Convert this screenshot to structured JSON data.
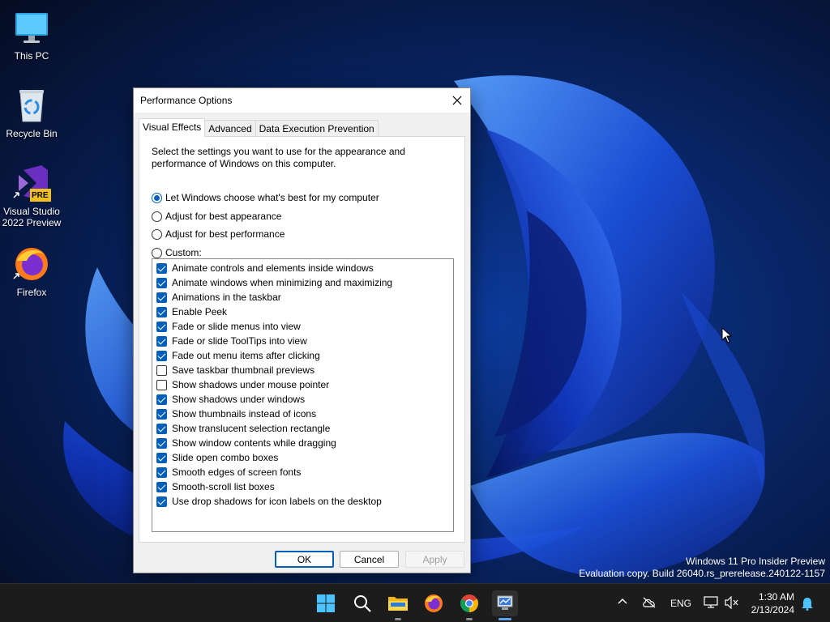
{
  "desktop": {
    "icons": [
      {
        "label": "This PC"
      },
      {
        "label": "Recycle Bin"
      },
      {
        "label": "Visual Studio 2022 Preview",
        "line1": "Visual Studio",
        "line2": "2022 Preview",
        "badge": "PRE"
      },
      {
        "label": "Firefox"
      }
    ],
    "watermark": {
      "line1": "Windows 11 Pro Insider Preview",
      "line2": "Evaluation copy. Build 26040.rs_prerelease.240122-1157"
    }
  },
  "dialog": {
    "title": "Performance Options",
    "tabs": [
      {
        "label": "Visual Effects",
        "active": true
      },
      {
        "label": "Advanced",
        "active": false
      },
      {
        "label": "Data Execution Prevention",
        "active": false
      }
    ],
    "description": "Select the settings you want to use for the appearance and performance of Windows on this computer.",
    "radios": [
      {
        "label": "Let Windows choose what's best for my computer",
        "checked": true
      },
      {
        "label": "Adjust for best appearance",
        "checked": false
      },
      {
        "label": "Adjust for best performance",
        "checked": false
      },
      {
        "label": "Custom:",
        "checked": false
      }
    ],
    "options": [
      {
        "label": "Animate controls and elements inside windows",
        "checked": true
      },
      {
        "label": "Animate windows when minimizing and maximizing",
        "checked": true
      },
      {
        "label": "Animations in the taskbar",
        "checked": true
      },
      {
        "label": "Enable Peek",
        "checked": true
      },
      {
        "label": "Fade or slide menus into view",
        "checked": true
      },
      {
        "label": "Fade or slide ToolTips into view",
        "checked": true
      },
      {
        "label": "Fade out menu items after clicking",
        "checked": true
      },
      {
        "label": "Save taskbar thumbnail previews",
        "checked": false
      },
      {
        "label": "Show shadows under mouse pointer",
        "checked": false
      },
      {
        "label": "Show shadows under windows",
        "checked": true
      },
      {
        "label": "Show thumbnails instead of icons",
        "checked": true
      },
      {
        "label": "Show translucent selection rectangle",
        "checked": true
      },
      {
        "label": "Show window contents while dragging",
        "checked": true
      },
      {
        "label": "Slide open combo boxes",
        "checked": true
      },
      {
        "label": "Smooth edges of screen fonts",
        "checked": true
      },
      {
        "label": "Smooth-scroll list boxes",
        "checked": true
      },
      {
        "label": "Use drop shadows for icon labels on the desktop",
        "checked": true
      }
    ],
    "buttons": {
      "ok": "OK",
      "cancel": "Cancel",
      "apply": "Apply"
    }
  },
  "taskbar": {
    "apps": [
      {
        "name": "start-button-icon"
      },
      {
        "name": "search-icon"
      },
      {
        "name": "file-explorer-icon"
      },
      {
        "name": "firefox-icon"
      },
      {
        "name": "chrome-icon"
      },
      {
        "name": "performance-options-icon",
        "active": true
      }
    ],
    "tray": {
      "language": "ENG",
      "time": "1:30 AM",
      "date": "2/13/2024"
    }
  },
  "colors": {
    "accent": "#005fb8",
    "taskbar": "#1c1c1c",
    "wallpaper_bg": "#0a1a3a"
  }
}
